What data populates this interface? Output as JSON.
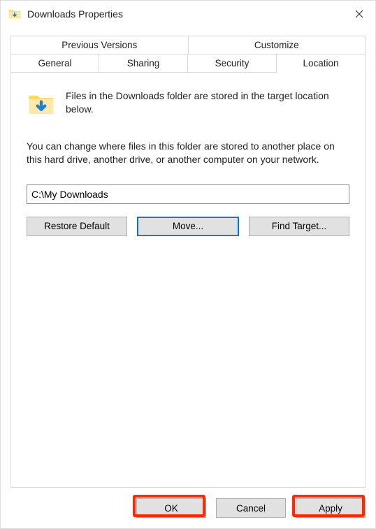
{
  "window": {
    "title": "Downloads Properties"
  },
  "tabs": {
    "previous_versions": "Previous Versions",
    "customize": "Customize",
    "general": "General",
    "sharing": "Sharing",
    "security": "Security",
    "location": "Location"
  },
  "panel": {
    "intro": "Files in the Downloads folder are stored in the target location below.",
    "description": "You can change where files in this folder are stored to another place on this hard drive, another drive, or another computer on your network.",
    "path_value": "C:\\My Downloads",
    "restore_default": "Restore Default",
    "move": "Move...",
    "find_target": "Find Target..."
  },
  "footer": {
    "ok": "OK",
    "cancel": "Cancel",
    "apply": "Apply"
  }
}
